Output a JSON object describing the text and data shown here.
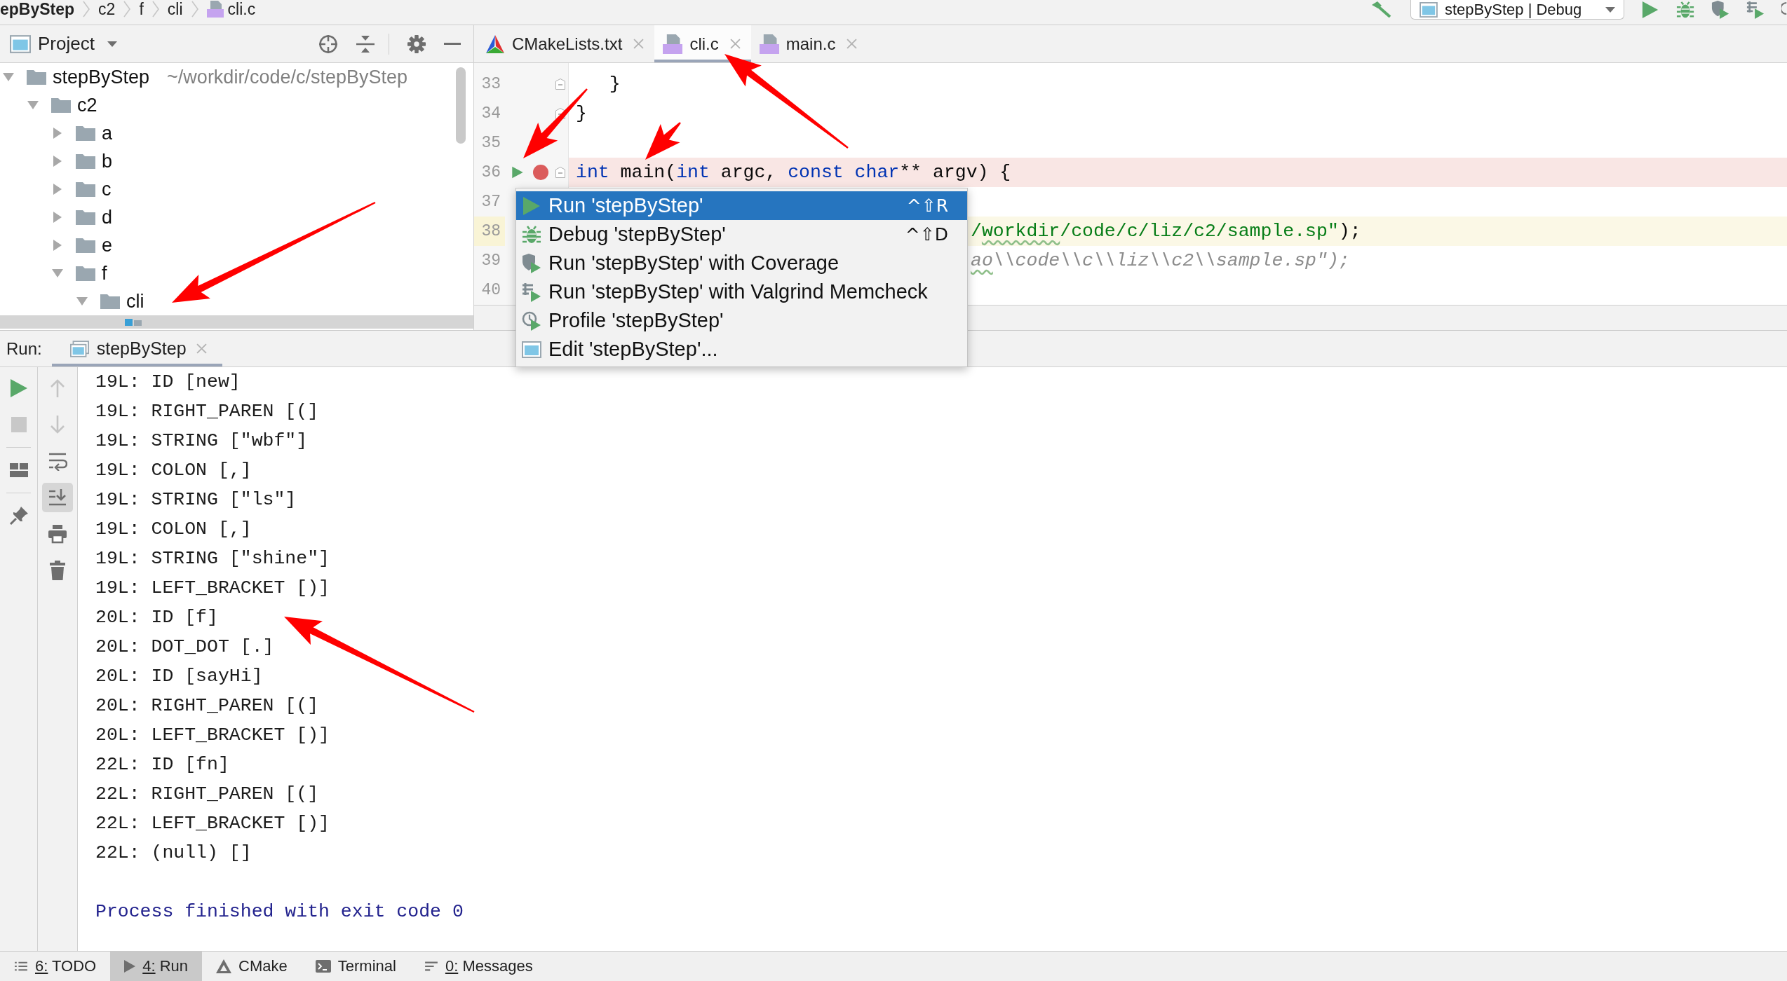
{
  "breadcrumbs": [
    {
      "label": "epByStep",
      "kind": "project"
    },
    {
      "label": "c2",
      "kind": "folder"
    },
    {
      "label": "f",
      "kind": "folder"
    },
    {
      "label": "cli",
      "kind": "folder"
    },
    {
      "label": "cli.c",
      "kind": "c_file"
    }
  ],
  "run_configuration": {
    "label": "stepByStep | Debug"
  },
  "project_panel": {
    "title": "Project",
    "tree": [
      {
        "label": "stepByStep",
        "path": "~/workdir/code/c/stepByStep",
        "kind": "folder",
        "expanded": true,
        "selected": false,
        "children": [
          {
            "label": "c2",
            "kind": "folder",
            "expanded": true,
            "selected": false,
            "children": [
              {
                "label": "a",
                "kind": "folder",
                "expanded": false,
                "selected": false
              },
              {
                "label": "b",
                "kind": "folder",
                "expanded": false,
                "selected": false
              },
              {
                "label": "c",
                "kind": "folder",
                "expanded": false,
                "selected": false
              },
              {
                "label": "d",
                "kind": "folder",
                "expanded": false,
                "selected": false
              },
              {
                "label": "e",
                "kind": "folder",
                "expanded": false,
                "selected": false
              },
              {
                "label": "f",
                "kind": "folder",
                "expanded": true,
                "selected": false,
                "children": [
                  {
                    "label": "cli",
                    "kind": "folder",
                    "expanded": true,
                    "selected": false,
                    "children": [
                      {
                        "kind": "file",
                        "selected": true
                      }
                    ]
                  }
                ]
              }
            ]
          }
        ]
      }
    ]
  },
  "editor": {
    "tabs": [
      {
        "label": "CMakeLists.txt",
        "kind": "cmake",
        "selected": false
      },
      {
        "label": "cli.c",
        "kind": "c_file",
        "selected": true
      },
      {
        "label": "main.c",
        "kind": "c_file",
        "selected": false
      }
    ],
    "lines": [
      {
        "number": "33",
        "fold": true,
        "run_marker": false,
        "breakpoint": false,
        "current": false,
        "covered": false,
        "segments": [
          {
            "kind": "plain",
            "text": "   }",
            "typo": false
          }
        ]
      },
      {
        "number": "34",
        "fold": true,
        "run_marker": false,
        "breakpoint": false,
        "current": false,
        "covered": false,
        "segments": [
          {
            "kind": "plain",
            "text": "}",
            "typo": false
          }
        ]
      },
      {
        "number": "35",
        "fold": false,
        "run_marker": false,
        "breakpoint": false,
        "current": false,
        "covered": false
      },
      {
        "number": "36",
        "fold": true,
        "run_marker": true,
        "breakpoint": true,
        "current": false,
        "covered": false,
        "segments": [
          {
            "kind": "keyword",
            "text": "int",
            "typo": false
          },
          {
            "kind": "plain",
            "text": " main(",
            "typo": false
          },
          {
            "kind": "keyword",
            "text": "int",
            "typo": false
          },
          {
            "kind": "plain",
            "text": " argc, ",
            "typo": false
          },
          {
            "kind": "keyword",
            "text": "const char",
            "typo": false
          },
          {
            "kind": "plain",
            "text": "** argv) {",
            "typo": false
          }
        ]
      },
      {
        "number": "37",
        "fold": false,
        "run_marker": false,
        "breakpoint": false,
        "current": false,
        "covered": false
      },
      {
        "number": "38",
        "fold": false,
        "run_marker": false,
        "breakpoint": false,
        "current": true,
        "covered": true,
        "segments": [
          {
            "kind": "string",
            "text": "/",
            "typo": false
          },
          {
            "kind": "string",
            "text": "workdir",
            "typo": true
          },
          {
            "kind": "string",
            "text": "/code/c/liz/c2/sample.sp\"",
            "typo": false
          },
          {
            "kind": "plain",
            "text": ");",
            "typo": false
          }
        ]
      },
      {
        "number": "39",
        "fold": false,
        "run_marker": false,
        "breakpoint": false,
        "current": false,
        "covered": true,
        "segments": [
          {
            "kind": "comment",
            "text": "ao",
            "typo": true
          },
          {
            "kind": "comment",
            "text": "\\\\code\\\\c\\\\liz\\\\c2\\\\sample.sp\");",
            "typo": false
          }
        ]
      },
      {
        "number": "40",
        "fold": false,
        "run_marker": false,
        "breakpoint": false,
        "current": false,
        "covered": false
      }
    ]
  },
  "context_menu": {
    "items": [
      {
        "label": "Run 'stepByStep'",
        "kind": "run",
        "shortcut": "^⇧R",
        "selected": true
      },
      {
        "label": "Debug 'stepByStep'",
        "kind": "debug",
        "shortcut": "^⇧D",
        "selected": false
      },
      {
        "label": "Run 'stepByStep' with Coverage",
        "kind": "coverage",
        "selected": false
      },
      {
        "label": "Run 'stepByStep' with Valgrind Memcheck",
        "kind": "valgrind",
        "selected": false
      },
      {
        "label": "Profile 'stepByStep'",
        "kind": "profile",
        "selected": false
      },
      {
        "label": "Edit 'stepByStep'...",
        "kind": "edit",
        "selected": false
      }
    ]
  },
  "run_panel": {
    "label": "Run:",
    "tabs": [
      {
        "label": "stepByStep",
        "selected": true
      }
    ],
    "side_toolbars": [
      {
        "groups": [
          {
            "tools": [
              {
                "kind": "rerun",
                "disabled": false,
                "on": false
              },
              {
                "kind": "stop",
                "disabled": true,
                "on": false
              }
            ]
          },
          {
            "tools": [
              {
                "kind": "layout",
                "disabled": false,
                "on": false
              }
            ]
          },
          {
            "tools": [
              {
                "kind": "pin",
                "disabled": false,
                "on": false
              }
            ]
          }
        ]
      },
      {
        "groups": [
          {
            "tools": [
              {
                "kind": "up",
                "disabled": true,
                "on": false
              },
              {
                "kind": "down",
                "disabled": true,
                "on": false
              },
              {
                "kind": "soft_wrap",
                "disabled": false,
                "on": false
              },
              {
                "kind": "scroll_to_end",
                "disabled": false,
                "on": true
              },
              {
                "kind": "print",
                "disabled": false,
                "on": false
              },
              {
                "kind": "clear",
                "disabled": false,
                "on": false
              }
            ]
          }
        ]
      }
    ],
    "output": [
      {
        "text": "19L: ID [new]",
        "kind": "stdout"
      },
      {
        "text": "19L: RIGHT_PAREN [(]",
        "kind": "stdout"
      },
      {
        "text": "19L: STRING [\"wbf\"]",
        "kind": "stdout"
      },
      {
        "text": "19L: COLON [,]",
        "kind": "stdout"
      },
      {
        "text": "19L: STRING [\"ls\"]",
        "kind": "stdout"
      },
      {
        "text": "19L: COLON [,]",
        "kind": "stdout"
      },
      {
        "text": "19L: STRING [\"shine\"]",
        "kind": "stdout"
      },
      {
        "text": "19L: LEFT_BRACKET [)]",
        "kind": "stdout"
      },
      {
        "text": "20L: ID [f]",
        "kind": "stdout"
      },
      {
        "text": "20L: DOT_DOT [.]",
        "kind": "stdout"
      },
      {
        "text": "20L: ID [sayHi]",
        "kind": "stdout"
      },
      {
        "text": "20L: RIGHT_PAREN [(]",
        "kind": "stdout"
      },
      {
        "text": "20L: LEFT_BRACKET [)]",
        "kind": "stdout"
      },
      {
        "text": "22L: ID [fn]",
        "kind": "stdout"
      },
      {
        "text": "22L: RIGHT_PAREN [(]",
        "kind": "stdout"
      },
      {
        "text": "22L: LEFT_BRACKET [)]",
        "kind": "stdout"
      },
      {
        "text": "22L: (null) []",
        "kind": "stdout"
      },
      {
        "text": "Process finished with exit code 0",
        "kind": "system"
      }
    ]
  },
  "tool_window_bar": {
    "items": [
      {
        "label": "6: TODO",
        "kind": "todo",
        "selected": false,
        "mnemonic": true
      },
      {
        "label": "4: Run",
        "kind": "run",
        "selected": true,
        "mnemonic": true
      },
      {
        "label": "CMake",
        "kind": "cmake",
        "selected": false,
        "mnemonic": false
      },
      {
        "label": "Terminal",
        "kind": "terminal",
        "selected": false,
        "mnemonic": false
      },
      {
        "label": "0: Messages",
        "kind": "messages",
        "selected": false,
        "mnemonic": true
      }
    ]
  }
}
